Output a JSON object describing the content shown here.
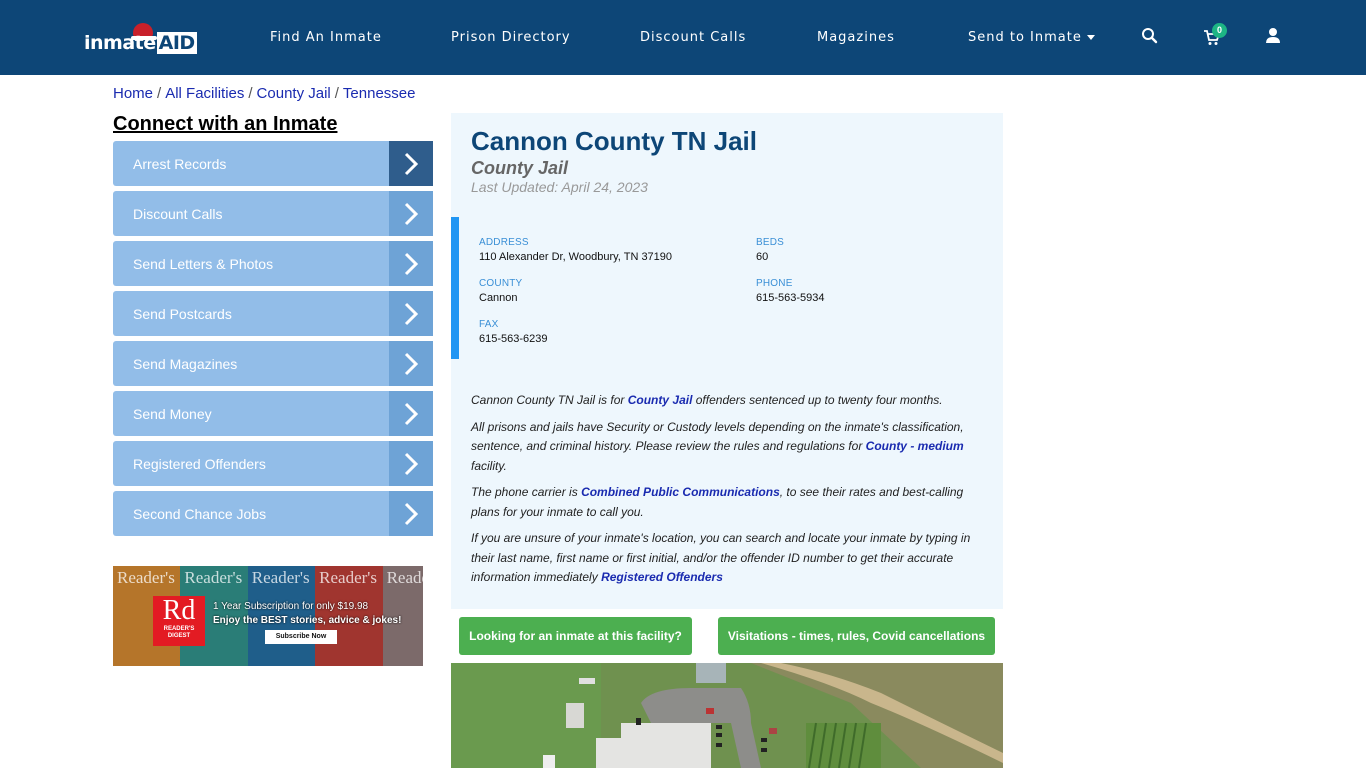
{
  "header": {
    "logo_text": "inmate",
    "logo_accent": "AID",
    "nav": [
      {
        "label": "Find An Inmate"
      },
      {
        "label": "Prison Directory"
      },
      {
        "label": "Discount Calls"
      },
      {
        "label": "Magazines"
      },
      {
        "label": "Send to Inmate",
        "has_dropdown": true
      }
    ],
    "cart_count": "0",
    "icons": [
      "search-icon",
      "cart-icon",
      "user-icon"
    ]
  },
  "breadcrumb": [
    "Home",
    "All Facilities",
    "County Jail",
    "Tennessee"
  ],
  "sidebar": {
    "title": "Connect with an Inmate",
    "items": [
      {
        "label": "Arrest Records"
      },
      {
        "label": "Discount Calls"
      },
      {
        "label": "Send Letters & Photos"
      },
      {
        "label": "Send Postcards"
      },
      {
        "label": "Send Magazines"
      },
      {
        "label": "Send Money"
      },
      {
        "label": "Registered Offenders"
      },
      {
        "label": "Second Chance Jobs"
      }
    ]
  },
  "ad": {
    "brand": "Rd",
    "brand_sub": "READER'S DIGEST",
    "cover_title": "Reader's",
    "line1": "1 Year Subscription for only $19.98",
    "line2": "Enjoy the BEST stories, advice & jokes!",
    "cta": "Subscribe Now"
  },
  "facility": {
    "name": "Cannon County TN Jail",
    "type": "County Jail",
    "last_updated": "Last Updated: April 24, 2023",
    "fields": {
      "address": {
        "label": "ADDRESS",
        "value": "110 Alexander Dr, Woodbury, TN 37190"
      },
      "beds": {
        "label": "BEDS",
        "value": "60"
      },
      "county": {
        "label": "COUNTY",
        "value": "Cannon"
      },
      "phone": {
        "label": "PHONE",
        "value": "615-563-5934"
      },
      "fax": {
        "label": "FAX",
        "value": "615-563-6239"
      }
    },
    "desc": {
      "p1a": "Cannon County TN Jail is for ",
      "p1link": "County Jail",
      "p1b": " offenders sentenced up to twenty four months.",
      "p2a": "All prisons and jails have Security or Custody levels depending on the inmate's classification, sentence, and criminal history. Please review the rules and regulations for ",
      "p2link": "County - medium",
      "p2b": " facility.",
      "p3a": "The phone carrier is ",
      "p3link": "Combined Public Communications",
      "p3b": ", to see their rates and best-calling plans for your inmate to call you.",
      "p4a": "If you are unsure of your inmate's location, you can search and locate your inmate by typing in their last name, first name or first initial, and/or the offender ID number to get their accurate information immediately ",
      "p4link": "Registered Offenders"
    }
  },
  "buttons": {
    "find_inmate": "Looking for an inmate at this facility?",
    "visitations": "Visitations - times, rules, Covid cancellations"
  },
  "colors": {
    "header_bg": "#0d4677",
    "sidebar_item": "#92bde8",
    "green_button": "#4caf50",
    "info_accent": "#2196f3"
  }
}
